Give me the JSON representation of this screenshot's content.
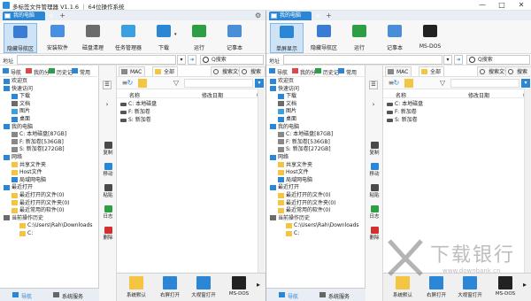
{
  "window": {
    "title": "多标签文件管理器 V1.1.6 ｜ 64位操作系统",
    "controls": [
      "—",
      "□",
      "✕"
    ]
  },
  "left": {
    "tab": "我的电脑",
    "toolbar": [
      {
        "label": "隐藏导航区",
        "icon": "navigation-pane-icon"
      },
      {
        "label": "安装软件",
        "icon": "install-software-icon"
      },
      {
        "label": "磁盘清理",
        "icon": "disk-cleanup-icon"
      },
      {
        "label": "任务管理器",
        "icon": "task-manager-icon"
      },
      {
        "label": "下载",
        "icon": "download-icon"
      },
      {
        "label": "运行",
        "icon": "run-icon"
      },
      {
        "label": "记事本",
        "icon": "notepad-icon"
      }
    ],
    "address_label": "地址",
    "search_placeholder": "Q搜索",
    "nav_top": [
      "导航",
      "我的分",
      "历史记",
      "常用"
    ],
    "tree": [
      {
        "label": "欢迎页",
        "indent": 0,
        "icon": "welcome-icon"
      },
      {
        "label": "快速访问",
        "indent": 0,
        "icon": "star-icon"
      },
      {
        "label": "下载",
        "indent": 1,
        "icon": "download-folder-icon"
      },
      {
        "label": "文档",
        "indent": 1,
        "icon": "document-icon"
      },
      {
        "label": "图片",
        "indent": 1,
        "icon": "picture-icon"
      },
      {
        "label": "桌面",
        "indent": 1,
        "icon": "desktop-icon"
      },
      {
        "label": "我的电脑",
        "indent": 0,
        "icon": "computer-icon"
      },
      {
        "label": "C: 本地磁盘[87GB]",
        "indent": 1,
        "icon": "drive-icon"
      },
      {
        "label": "F: 新加卷[536GB]",
        "indent": 1,
        "icon": "drive-icon"
      },
      {
        "label": "S: 新加卷[272GB]",
        "indent": 1,
        "icon": "drive-icon"
      },
      {
        "label": "网络",
        "indent": 0,
        "icon": "network-icon"
      },
      {
        "label": "共享文件夹",
        "indent": 1,
        "icon": "folder-icon"
      },
      {
        "label": "Host文件",
        "indent": 1,
        "icon": "folder-icon"
      },
      {
        "label": "局域网电脑",
        "indent": 1,
        "icon": "network-computer-icon"
      },
      {
        "label": "最近打开",
        "indent": 0,
        "icon": "recent-icon"
      },
      {
        "label": "最近打开的文件(0)",
        "indent": 1,
        "icon": "folder-icon"
      },
      {
        "label": "最近打开的文件夹(0)",
        "indent": 1,
        "icon": "folder-icon"
      },
      {
        "label": "最近常用的软件(0)",
        "indent": 1,
        "icon": "folder-icon"
      },
      {
        "label": "当前操作历史",
        "indent": 0,
        "icon": "history-icon"
      },
      {
        "label": "C:\\Users\\Rah\\Downloads",
        "indent": 2,
        "icon": "folder-icon"
      },
      {
        "label": "C:",
        "indent": 2,
        "icon": "folder-icon"
      }
    ],
    "nav_bottom": [
      "导航",
      "系统服务"
    ],
    "actions": [
      "复制",
      "移动",
      "粘贴",
      "日志",
      "删除"
    ],
    "fv_tabs": [
      "MAC",
      "全部",
      "搜索文件",
      "搜索文件"
    ],
    "fv_head": {
      "name": "名称",
      "date": "修改日期"
    },
    "files": [
      "C: 本地磁盘",
      "F: 新加卷",
      "S: 新加卷"
    ],
    "bottom": [
      "系统默认",
      "右屏打开",
      "大视窗打开",
      "MS-DOS"
    ]
  },
  "right": {
    "tab": "我的电脑",
    "toolbar": [
      {
        "label": "单屏显示",
        "icon": "single-screen-icon"
      },
      {
        "label": "隐藏导航区",
        "icon": "navigation-pane-icon"
      },
      {
        "label": "运行",
        "icon": "run-icon"
      },
      {
        "label": "记事本",
        "icon": "notepad-icon"
      },
      {
        "label": "MS-DOS",
        "icon": "ms-dos-icon"
      }
    ],
    "address_label": "地址",
    "search_placeholder": "Q搜索",
    "nav_top": [
      "导航",
      "我的分",
      "历史记",
      "常用"
    ],
    "tree": [
      {
        "label": "欢迎页",
        "indent": 0,
        "icon": "welcome-icon"
      },
      {
        "label": "快速访问",
        "indent": 0,
        "icon": "star-icon"
      },
      {
        "label": "下载",
        "indent": 1,
        "icon": "download-folder-icon"
      },
      {
        "label": "文档",
        "indent": 1,
        "icon": "document-icon"
      },
      {
        "label": "图片",
        "indent": 1,
        "icon": "picture-icon"
      },
      {
        "label": "桌面",
        "indent": 1,
        "icon": "desktop-icon"
      },
      {
        "label": "我的电脑",
        "indent": 0,
        "icon": "computer-icon"
      },
      {
        "label": "C: 本地磁盘[87GB]",
        "indent": 1,
        "icon": "drive-icon"
      },
      {
        "label": "F: 新加卷[536GB]",
        "indent": 1,
        "icon": "drive-icon"
      },
      {
        "label": "S: 新加卷[272GB]",
        "indent": 1,
        "icon": "drive-icon"
      },
      {
        "label": "网络",
        "indent": 0,
        "icon": "network-icon"
      },
      {
        "label": "共享文件夹",
        "indent": 1,
        "icon": "folder-icon"
      },
      {
        "label": "Host文件",
        "indent": 1,
        "icon": "folder-icon"
      },
      {
        "label": "局域网电脑",
        "indent": 1,
        "icon": "network-computer-icon"
      },
      {
        "label": "最近打开",
        "indent": 0,
        "icon": "recent-icon"
      },
      {
        "label": "最近打开的文件(0)",
        "indent": 1,
        "icon": "folder-icon"
      },
      {
        "label": "最近打开的文件夹(0)",
        "indent": 1,
        "icon": "folder-icon"
      },
      {
        "label": "最近常用的软件(0)",
        "indent": 1,
        "icon": "folder-icon"
      },
      {
        "label": "当前操作历史",
        "indent": 0,
        "icon": "history-icon"
      },
      {
        "label": "C:\\Users\\Rah\\Downloads",
        "indent": 2,
        "icon": "folder-icon"
      },
      {
        "label": "C:",
        "indent": 2,
        "icon": "folder-icon"
      }
    ],
    "nav_bottom": [
      "导航",
      "系统服务"
    ],
    "actions": [
      "复制",
      "移动",
      "粘贴",
      "日志",
      "删除"
    ],
    "fv_tabs": [
      "MAC",
      "全部",
      "搜索文件",
      "搜索文件"
    ],
    "fv_head": {
      "name": "名称",
      "date": "修改日期"
    },
    "files": [
      "C: 本地磁盘",
      "F: 新加卷",
      "S: 新加卷"
    ],
    "bottom": [
      "系统默认",
      "右屏打开",
      "大视窗打开",
      "MS-DOS"
    ]
  },
  "watermark": {
    "text": "下载银行",
    "sub": "www.downbank.cn"
  },
  "colors": {
    "accent": "#2b86d6",
    "folder": "#f4c542",
    "delete": "#d32f2f",
    "green": "#2e9e44"
  }
}
